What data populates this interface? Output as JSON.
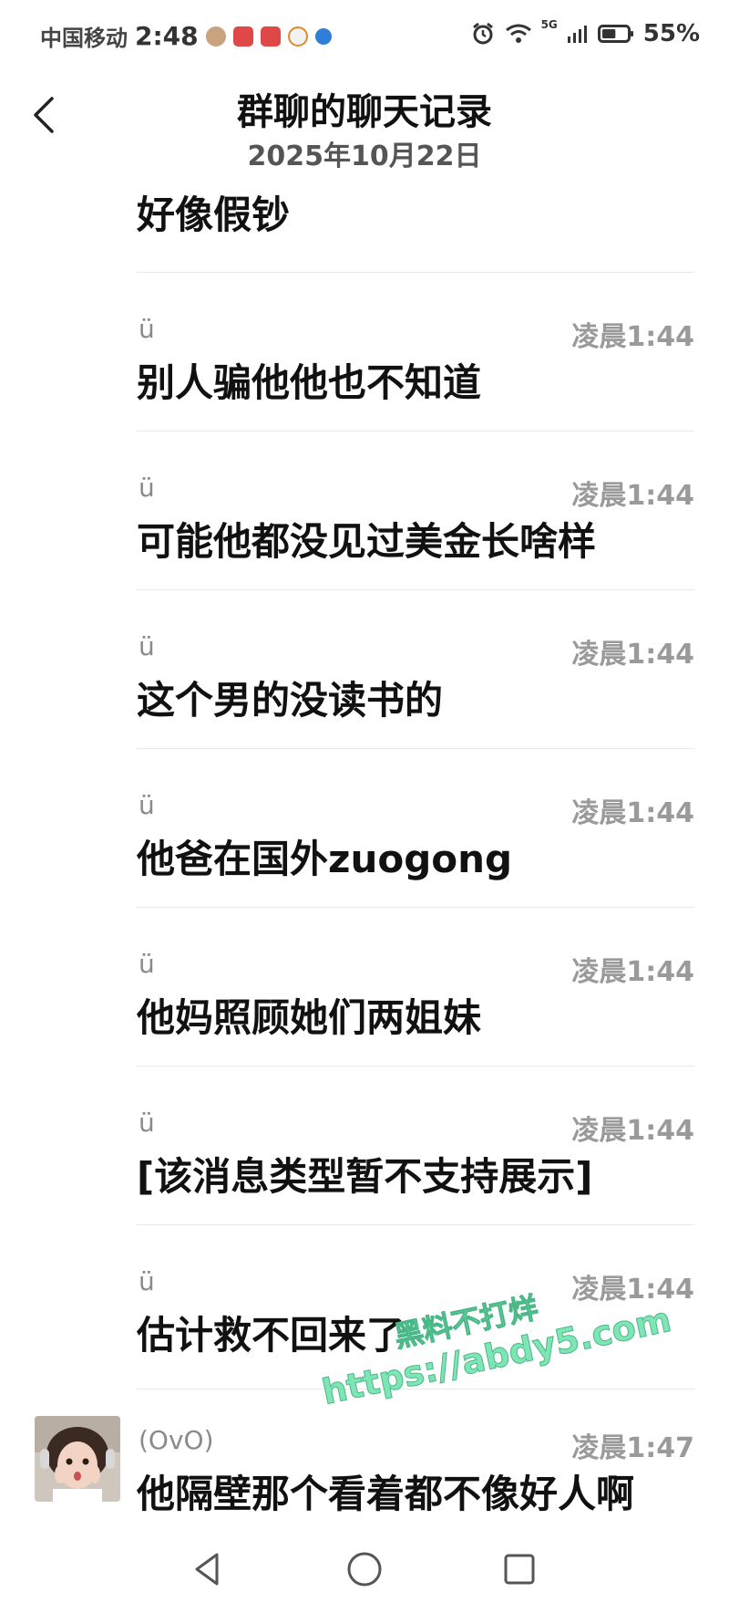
{
  "status_bar": {
    "carrier": "中国移动",
    "time": "2:48",
    "battery": "55%",
    "network": "5G",
    "battery_level": 0.55
  },
  "header": {
    "title": "群聊的聊天记录",
    "date": "2025年10月22日"
  },
  "messages": [
    {
      "sender": "ü",
      "time": "凌晨1:44",
      "text": "好像假钞"
    },
    {
      "sender": "ü",
      "time": "凌晨1:44",
      "text": "别人骗他他也不知道"
    },
    {
      "sender": "ü",
      "time": "凌晨1:44",
      "text": "可能他都没见过美金长啥样"
    },
    {
      "sender": "ü",
      "time": "凌晨1:44",
      "text": "这个男的没读书的"
    },
    {
      "sender": "ü",
      "time": "凌晨1:44",
      "text": "他爸在国外zuogong"
    },
    {
      "sender": "ü",
      "time": "凌晨1:44",
      "text": "他妈照顾她们两姐妹"
    },
    {
      "sender": "ü",
      "time": "凌晨1:44",
      "text": "[该消息类型暂不支持展示]"
    },
    {
      "sender": "ü",
      "time": "凌晨1:44",
      "text": "估计救不回来了"
    },
    {
      "sender": "(OvO)",
      "time": "凌晨1:47",
      "text": "他隔壁那个看着都不像好人啊"
    }
  ],
  "watermark": {
    "line1": "黑料不打烊",
    "line2": "https://abdy5.com"
  },
  "icons": {
    "back": "back-chevron-icon",
    "nav_back": "nav-back-triangle-icon",
    "nav_home": "nav-home-circle-icon",
    "nav_recents": "nav-recents-square-icon"
  },
  "colors": {
    "watermark": "#7ee6b4",
    "time_text": "#9a9a9a"
  }
}
